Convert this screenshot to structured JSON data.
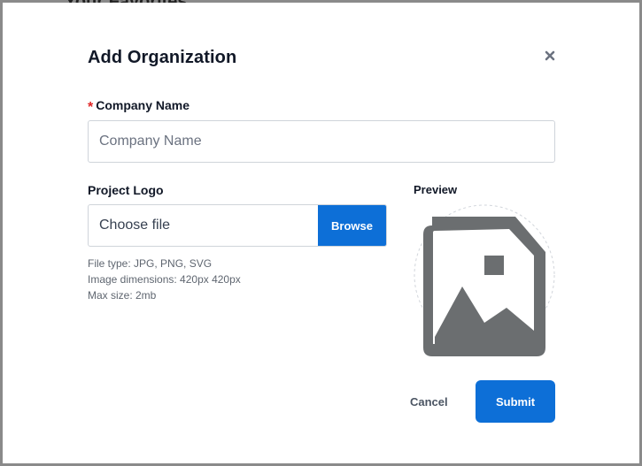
{
  "background": {
    "peek_text": "Your Favorites"
  },
  "modal": {
    "title": "Add Organization",
    "close_icon": "close-icon"
  },
  "company": {
    "required_marker": "*",
    "label": "Company Name",
    "placeholder": "Company Name",
    "value": ""
  },
  "logo": {
    "label": "Project Logo",
    "file_text": "Choose file",
    "browse_label": "Browse",
    "hints": [
      "File type: JPG, PNG, SVG",
      "Image dimensions: 420px 420px",
      "Max size: 2mb"
    ]
  },
  "preview": {
    "label": "Preview",
    "icon": "image-placeholder-icon"
  },
  "actions": {
    "cancel_label": "Cancel",
    "submit_label": "Submit"
  },
  "colors": {
    "primary": "#0d6fd7",
    "required": "#e02424",
    "placeholder_icon": "#6b6e70"
  }
}
